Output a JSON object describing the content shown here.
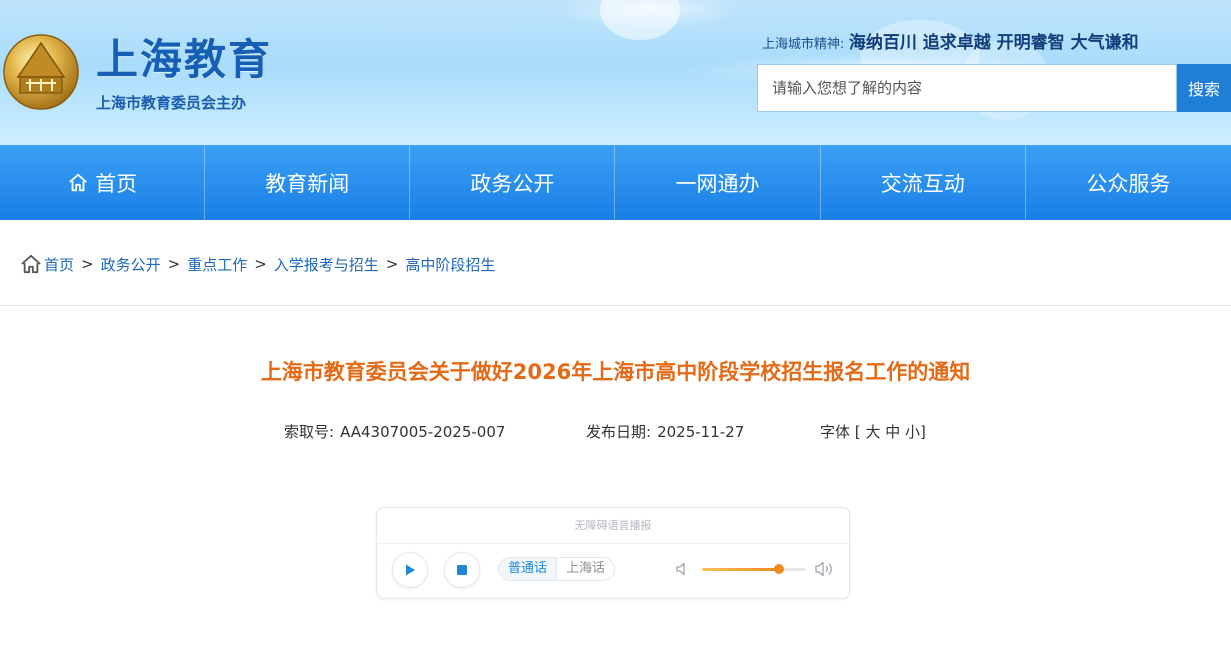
{
  "header": {
    "logo_title": "上海教育",
    "logo_subtitle": "上海市教育委员会主办",
    "slogan_label": "上海城市精神:",
    "slogan_text": "海纳百川 追求卓越 开明睿智 大气谦和",
    "search_placeholder": "请输入您想了解的内容",
    "search_button": "搜索"
  },
  "nav": {
    "items": [
      "首页",
      "教育新闻",
      "政务公开",
      "一网通办",
      "交流互动",
      "公众服务"
    ]
  },
  "breadcrumb": {
    "items": [
      "首页",
      "政务公开",
      "重点工作",
      "入学报考与招生",
      "高中阶段招生"
    ],
    "separator": ">"
  },
  "article": {
    "title": "上海市教育委员会关于做好2026年上海市高中阶段学校招生报名工作的通知",
    "index_label": "索取号:",
    "index_value": "AA4307005-2025-007",
    "date_label": "发布日期:",
    "date_value": "2025-11-27",
    "font_label": "字体",
    "font_open": "[",
    "font_large": "大",
    "font_medium": "中",
    "font_small": "小",
    "font_close": "]"
  },
  "player": {
    "header": "无障碍语音播报",
    "lang_mandarin": "普通话",
    "lang_shanghai": "上海话",
    "volume_level": 0.74
  },
  "colors": {
    "primary_blue": "#1a7fe6",
    "title_orange": "#e36a17",
    "link_blue": "#1d68b8"
  }
}
